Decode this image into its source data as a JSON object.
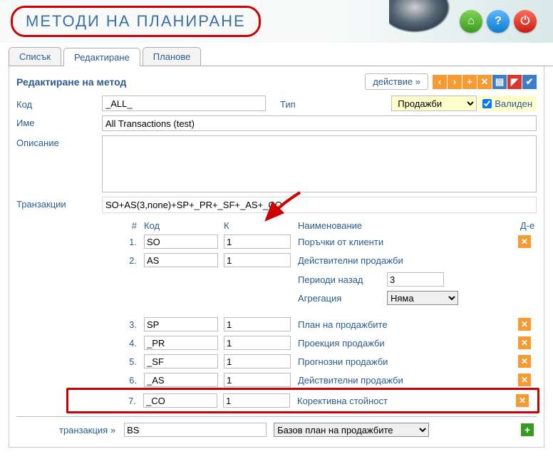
{
  "header": {
    "title": "МЕТОДИ НА ПЛАНИРАНЕ"
  },
  "tabs": {
    "list": "Списък",
    "edit": "Редактиране",
    "plans": "Планове"
  },
  "panel": {
    "title": "Редактиране на метод",
    "action_label": "действие »"
  },
  "fields": {
    "code_label": "Код",
    "code_value": "_ALL_",
    "type_label": "Тип",
    "type_value": "Продажби",
    "valid_label": "Валиден",
    "valid_checked": true,
    "name_label": "Име",
    "name_value": "All Transactions (test)",
    "desc_label": "Описание",
    "desc_value": "",
    "tx_label": "Транзакции",
    "tx_value": "SO+AS(3,none)+SP+_PR+_SF+_AS+_CO"
  },
  "tx_header": {
    "num": "#",
    "code": "Код",
    "k": "К",
    "name": "Наименование",
    "act": "Д-е"
  },
  "tx_rows": [
    {
      "num": "1.",
      "code": "SO",
      "k": "1",
      "name": "Поръчки от клиенти"
    },
    {
      "num": "2.",
      "code": "AS",
      "k": "1",
      "name": "Действителни продажби"
    }
  ],
  "sub": {
    "periods_label": "Периоди назад",
    "periods_value": "3",
    "agg_label": "Агрегация",
    "agg_value": "Няма"
  },
  "tx_rows2": [
    {
      "num": "3.",
      "code": "SP",
      "k": "1",
      "name": "План на продажбите"
    },
    {
      "num": "4.",
      "code": "_PR",
      "k": "1",
      "name": "Проекция продажби"
    },
    {
      "num": "5.",
      "code": "_SF",
      "k": "1",
      "name": "Прогнозни продажби"
    },
    {
      "num": "6.",
      "code": "_AS",
      "k": "1",
      "name": "Действителни продажби"
    },
    {
      "num": "7.",
      "code": "_CO",
      "k": "1",
      "name": "Корективна стойност"
    }
  ],
  "footer": {
    "link": "транзакция »",
    "code": "BS",
    "select": "Базов план на продажбите"
  }
}
